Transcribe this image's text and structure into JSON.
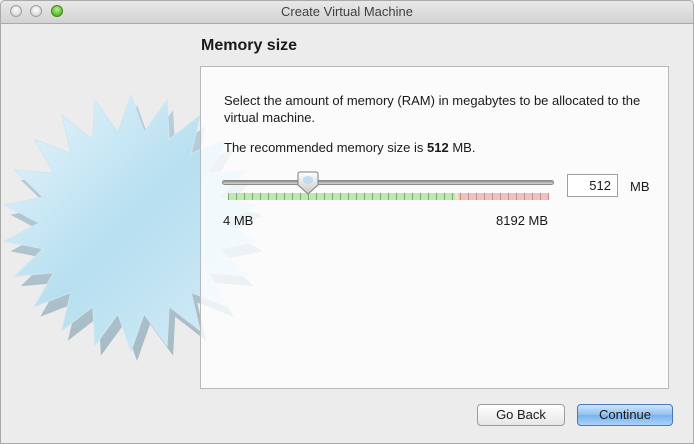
{
  "window": {
    "title": "Create Virtual Machine"
  },
  "section": {
    "title": "Memory size"
  },
  "description": "Select the amount of memory (RAM) in megabytes to be allocated to the virtual machine.",
  "recommendation": {
    "prefix": "The recommended memory size is ",
    "value": "512",
    "suffix": " MB."
  },
  "memory": {
    "value": "512",
    "unit": "MB",
    "min_label": "4 MB",
    "max_label": "8192 MB",
    "min_mb": 4,
    "max_mb": 8192,
    "current_mb": 512
  },
  "buttons": {
    "back": "Go Back",
    "continue": "Continue"
  },
  "colors": {
    "scale_safe": "#bfe8b1",
    "scale_warning": "#efc1bd",
    "default_button": "#8fc0f2"
  }
}
